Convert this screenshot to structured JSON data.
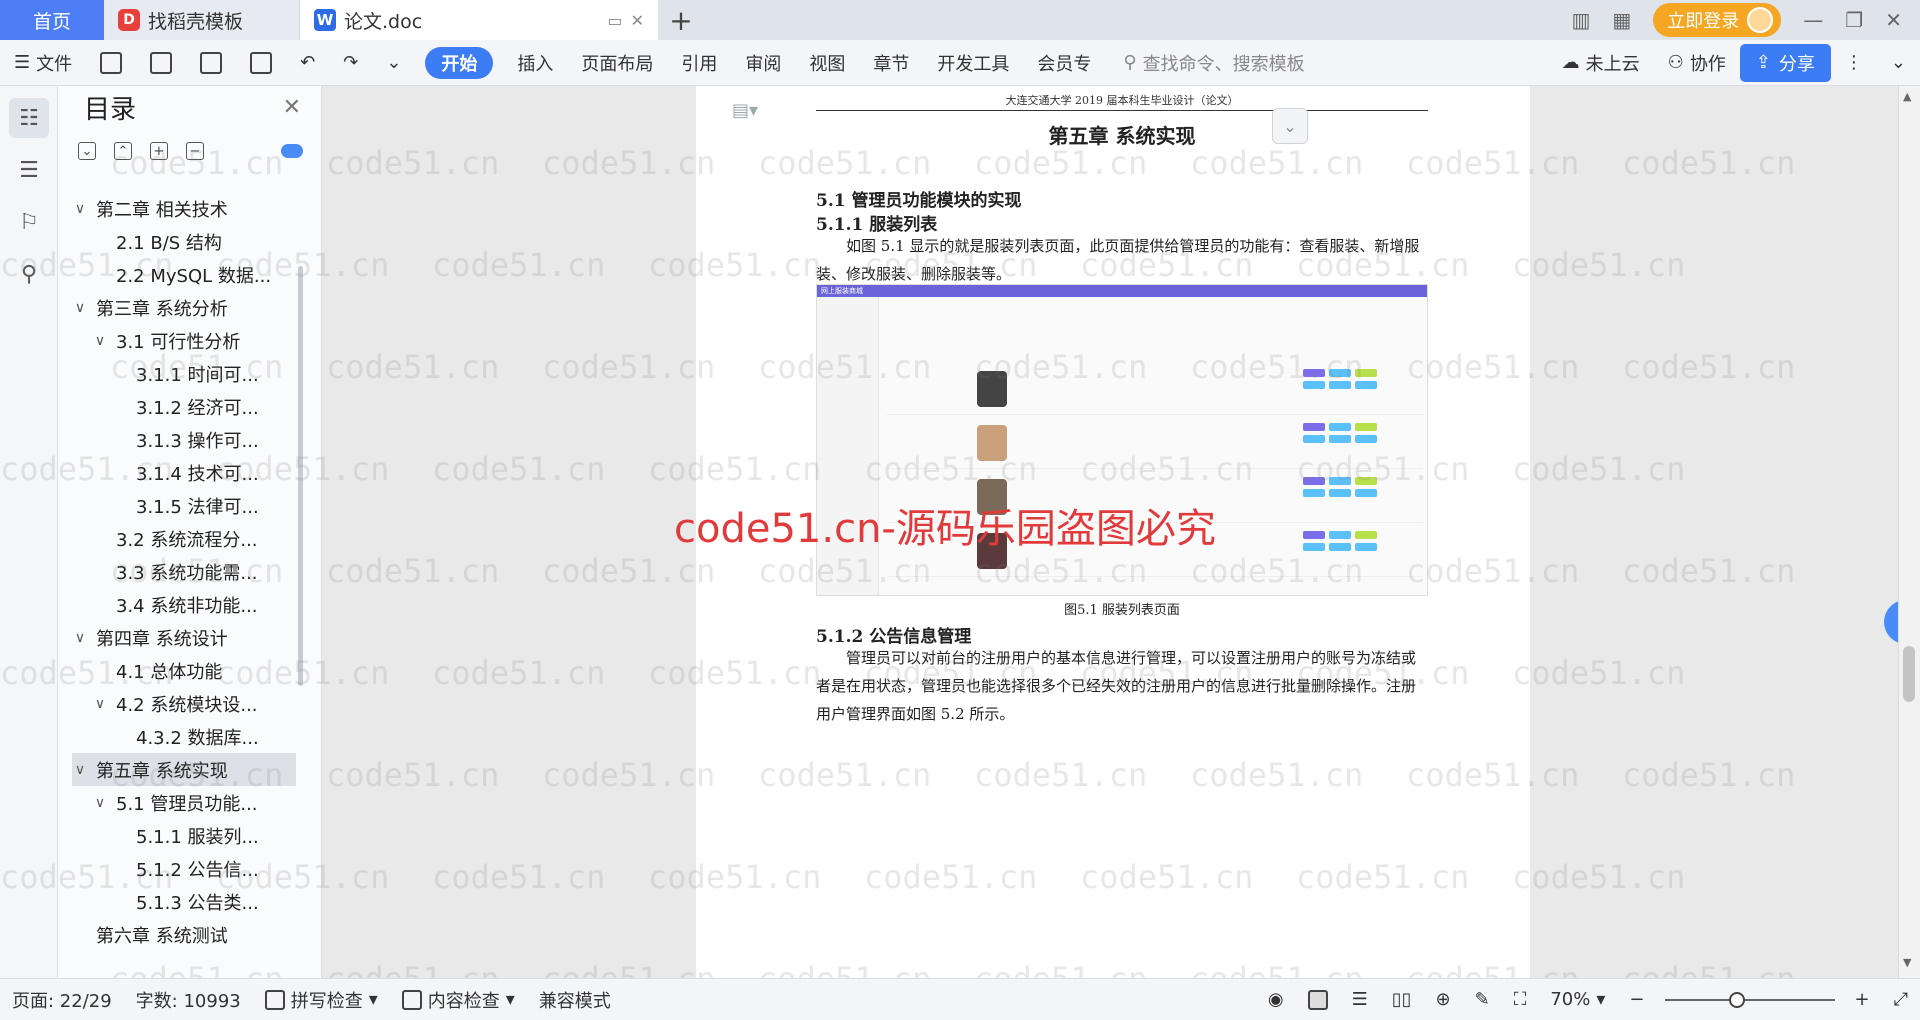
{
  "tabs": {
    "home": "首页",
    "template": "找稻壳模板",
    "doc": "论文.doc"
  },
  "titlebar": {
    "login": "立即登录"
  },
  "toolbar": {
    "file": "文件",
    "start": "开始",
    "insert": "插入",
    "layout": "页面布局",
    "reference": "引用",
    "review": "审阅",
    "view": "视图",
    "chapter": "章节",
    "devtools": "开发工具",
    "member": "会员专",
    "search": "查找命令、搜索模板",
    "cloud": "未上云",
    "collab": "协作",
    "share": "分享"
  },
  "toc": {
    "title": "目录",
    "items": [
      {
        "label": "第二章 相关技术",
        "level": 1,
        "caret": "∨"
      },
      {
        "label": "2.1 B/S 结构",
        "level": 2,
        "caret": ""
      },
      {
        "label": "2.2 MySQL 数据...",
        "level": 2,
        "caret": ""
      },
      {
        "label": "第三章 系统分析",
        "level": 1,
        "caret": "∨"
      },
      {
        "label": "3.1 可行性分析",
        "level": 2,
        "caret": "∨"
      },
      {
        "label": "3.1.1 时间可...",
        "level": 3,
        "caret": ""
      },
      {
        "label": "3.1.2 经济可...",
        "level": 3,
        "caret": ""
      },
      {
        "label": "3.1.3 操作可...",
        "level": 3,
        "caret": ""
      },
      {
        "label": "3.1.4 技术可...",
        "level": 3,
        "caret": ""
      },
      {
        "label": "3.1.5 法律可...",
        "level": 3,
        "caret": ""
      },
      {
        "label": "3.2 系统流程分...",
        "level": 2,
        "caret": ""
      },
      {
        "label": "3.3 系统功能需...",
        "level": 2,
        "caret": ""
      },
      {
        "label": "3.4 系统非功能...",
        "level": 2,
        "caret": ""
      },
      {
        "label": "第四章 系统设计",
        "level": 1,
        "caret": "∨"
      },
      {
        "label": "4.1 总体功能",
        "level": 2,
        "caret": ""
      },
      {
        "label": "4.2 系统模块设...",
        "level": 2,
        "caret": "∨"
      },
      {
        "label": "4.3.2 数据库...",
        "level": 3,
        "caret": ""
      },
      {
        "label": "第五章 系统实现",
        "level": 1,
        "caret": "∨",
        "selected": true
      },
      {
        "label": "5.1 管理员功能...",
        "level": 2,
        "caret": "∨"
      },
      {
        "label": "5.1.1 服装列...",
        "level": 3,
        "caret": ""
      },
      {
        "label": "5.1.2 公告信...",
        "level": 3,
        "caret": ""
      },
      {
        "label": "5.1.3 公告类...",
        "level": 3,
        "caret": ""
      },
      {
        "label": "第六章 系统测试",
        "level": 1,
        "caret": ""
      }
    ]
  },
  "page": {
    "header": "大连交通大学 2019 届本科生毕业设计（论文）",
    "chapter": "第五章 系统实现",
    "s51": "5.1 管理员功能模块的实现",
    "s511": "5.1.1 服装列表",
    "p1": "如图 5.1 显示的就是服装列表页面，此页面提供给管理员的功能有：查看服装、新增服装、修改服装、删除服装等。",
    "fig_title": "网上服装商城",
    "fig_caption": "图5.1 服装列表页面",
    "s512": "5.1.2 公告信息管理",
    "p2": "管理员可以对前台的注册用户的基本信息进行管理，可以设置注册用户的账号为冻结或者是在用状态，管理员也能选择很多个已经失效的注册用户的信息进行批量删除操作。注册用户管理界面如图 5.2 所示。"
  },
  "watermark": {
    "small": "code51.cn",
    "main": "code51.cn-源码乐园盗图必究"
  },
  "status": {
    "page": "页面: 22/29",
    "words": "字数: 10993",
    "spell": "拼写检查",
    "content_check": "内容检查",
    "compat": "兼容模式",
    "zoom": "70%"
  },
  "zoom_level": 0.7
}
